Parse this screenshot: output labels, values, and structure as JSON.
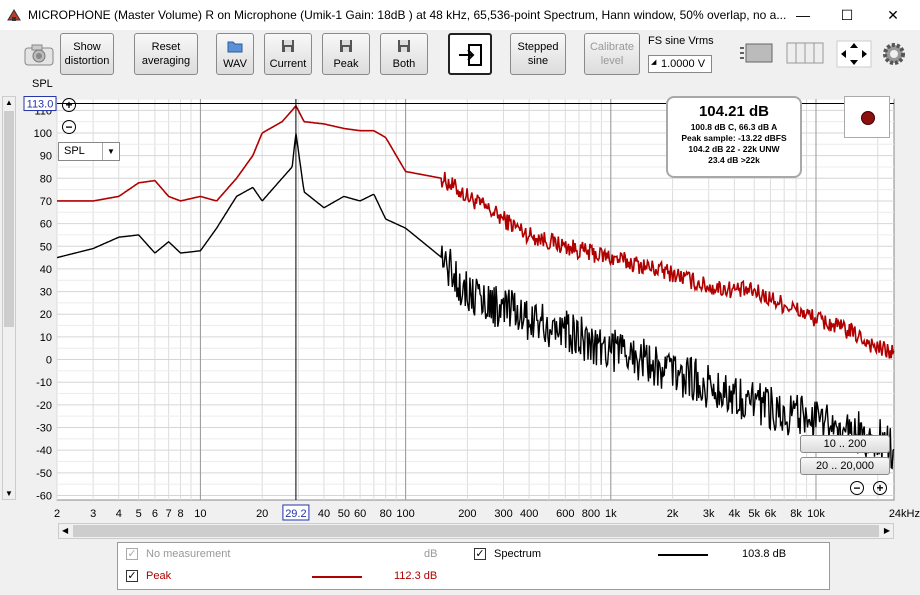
{
  "window": {
    "title": "MICROPHONE (Master Volume) R on Microphone (Umik-1  Gain: 18dB  ) at 48 kHz, 65,536-point Spectrum, Hann window, 50% overlap, no a...",
    "minimize": "—",
    "maximize": "☐",
    "close": "✕"
  },
  "toolbar": {
    "show_distortion": [
      "Show",
      "distortion"
    ],
    "reset_averaging": [
      "Reset",
      "averaging"
    ],
    "wav": "WAV",
    "current": "Current",
    "peak": "Peak",
    "both": "Both",
    "stepped_sine": [
      "Stepped",
      "sine"
    ],
    "calibrate_level": [
      "Calibrate",
      "level"
    ],
    "fs_label": "FS sine Vrms",
    "fs_value": "1.0000 V"
  },
  "plot": {
    "y_unit": "SPL",
    "y_cursor_value": "113.0",
    "x_cursor_value": "29.2",
    "mode_select": "SPL",
    "range_btn_1": "10 .. 200",
    "range_btn_2": "20 .. 20,000",
    "plus": "+",
    "minus": "−"
  },
  "readout": {
    "main": "104.21 dB",
    "line1": "100.8 dB C, 66.3 dB A",
    "line2": "Peak sample: -13.22 dBFS",
    "line3": "104.2 dB 22 - 22k UNW",
    "line4": "23.4 dB >22k"
  },
  "legend": {
    "rows": [
      {
        "check": "✓",
        "label": "No measurement",
        "value": "dB",
        "enabled": false
      },
      {
        "check": "✓",
        "label": "Peak",
        "value": "112.3 dB",
        "color": "#b00000"
      },
      {
        "check": "✓",
        "label": "Spectrum",
        "value": "103.8 dB",
        "color": "#000000"
      }
    ]
  },
  "chart_data": {
    "type": "line",
    "x_scale": "log",
    "xlim": [
      2,
      24000
    ],
    "ylim": [
      -60,
      115
    ],
    "x_ticks": [
      2,
      3,
      4,
      5,
      6,
      7,
      8,
      10,
      20,
      40,
      50,
      60,
      80,
      100,
      200,
      300,
      400,
      600,
      800,
      1000,
      2000,
      3000,
      4000,
      5000,
      6000,
      8000,
      10000,
      24000
    ],
    "x_tick_labels": [
      "2",
      "3",
      "4",
      "5",
      "6",
      "7",
      "8",
      "10",
      "20",
      "40",
      "50",
      "60",
      "80",
      "100",
      "200",
      "300",
      "400",
      "600",
      "800",
      "1k",
      "2k",
      "3k",
      "4k",
      "5k",
      "6k",
      "8k",
      "10k",
      "24kHz"
    ],
    "y_ticks": [
      -60,
      -50,
      -40,
      -30,
      -20,
      -10,
      0,
      10,
      20,
      30,
      40,
      50,
      60,
      70,
      80,
      90,
      100,
      110
    ],
    "cursor": {
      "x": 29.2,
      "y": 113
    },
    "grid": true,
    "series": [
      {
        "name": "Peak",
        "color": "#b00000",
        "x": [
          2,
          3,
          4,
          5,
          6,
          7,
          8,
          10,
          12,
          15,
          18,
          20,
          25,
          28,
          29.2,
          32,
          40,
          50,
          60,
          70,
          80,
          100,
          150,
          200,
          300,
          400,
          600,
          800,
          1000,
          2000,
          3000,
          5000,
          8000,
          10000,
          15000,
          20000,
          24000
        ],
        "values": [
          70,
          70,
          72,
          78,
          79,
          72,
          70,
          72,
          70,
          80,
          90,
          100,
          105,
          110,
          112,
          105,
          104,
          102,
          101,
          101,
          98,
          83,
          80,
          72,
          62,
          55,
          50,
          47,
          45,
          38,
          32,
          30,
          22,
          18,
          12,
          5,
          3
        ]
      },
      {
        "name": "Spectrum",
        "color": "#000000",
        "x": [
          2,
          3,
          4,
          5,
          6,
          7,
          8,
          10,
          12,
          15,
          18,
          20,
          25,
          28,
          29.2,
          32,
          40,
          50,
          60,
          70,
          80,
          100,
          150,
          200,
          300,
          400,
          600,
          800,
          1000,
          2000,
          3000,
          5000,
          8000,
          10000,
          15000,
          20000,
          24000
        ],
        "values": [
          45,
          49,
          54,
          55,
          47,
          52,
          47,
          48,
          58,
          72,
          76,
          70,
          80,
          85,
          100,
          74,
          67,
          72,
          70,
          73,
          62,
          58,
          45,
          30,
          22,
          18,
          12,
          8,
          5,
          -5,
          -12,
          -18,
          -25,
          -28,
          -32,
          -35,
          -40
        ]
      }
    ]
  }
}
